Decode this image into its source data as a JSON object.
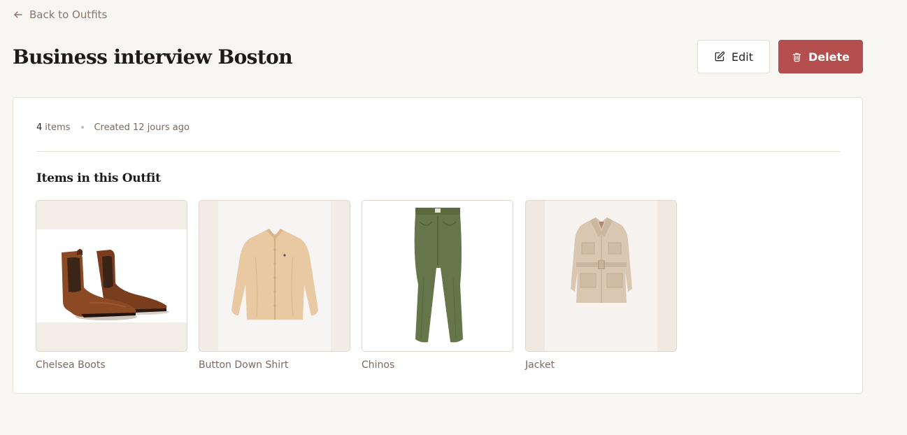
{
  "nav": {
    "back_label": "Back to Outfits"
  },
  "outfit": {
    "title": "Business interview Boston",
    "item_count": "4",
    "item_count_suffix": "items",
    "created": "Created 12 jours ago",
    "section_title": "Items in this Outfit"
  },
  "actions": {
    "edit_label": "Edit",
    "delete_label": "Delete"
  },
  "items": [
    {
      "label": "Chelsea Boots",
      "image": "brown-leather-chelsea-boots"
    },
    {
      "label": "Button Down Shirt",
      "image": "beige-button-down-shirt"
    },
    {
      "label": "Chinos",
      "image": "olive-green-chinos"
    },
    {
      "label": "Jacket",
      "image": "beige-belted-jacket"
    }
  ],
  "colors": {
    "background": "#f8f6f3",
    "accent_delete": "#b44f4d",
    "muted_text": "#7a6a60",
    "back_link": "#8a766a"
  }
}
